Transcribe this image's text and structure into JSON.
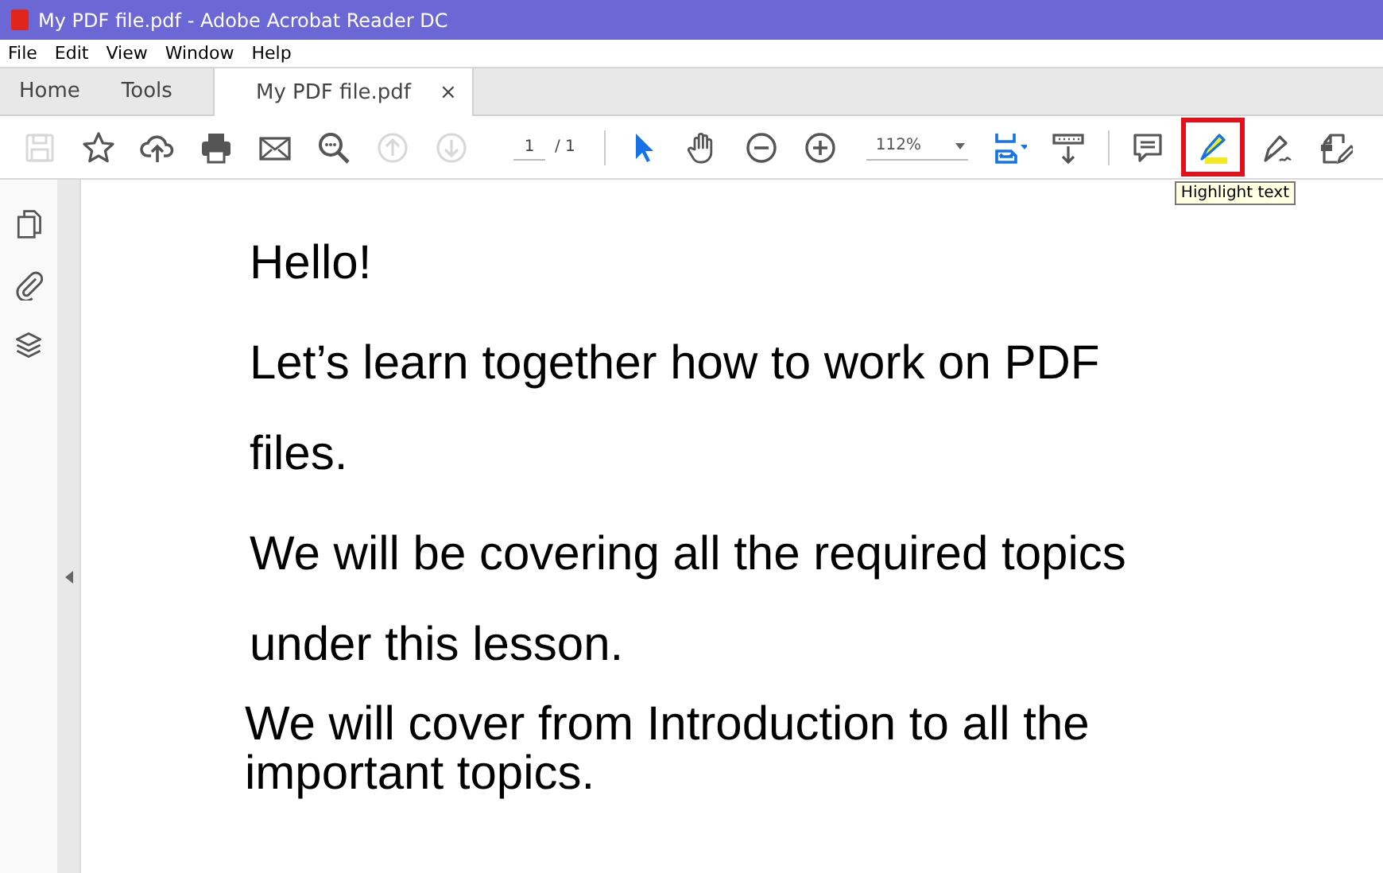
{
  "window": {
    "title": "My PDF file.pdf - Adobe Acrobat Reader DC"
  },
  "menu_bar": [
    "File",
    "Edit",
    "View",
    "Window",
    "Help"
  ],
  "tabs": [
    {
      "label": "Home",
      "selected": false
    },
    {
      "label": "Tools",
      "selected": false
    },
    {
      "label": "My PDF file.pdf",
      "selected": true,
      "close_glyph": "×"
    }
  ],
  "toolbar": [
    {
      "kind": "button",
      "disabled": true,
      "outlined": false
    },
    {
      "kind": "button",
      "disabled": false,
      "outlined": false
    },
    {
      "kind": "button",
      "disabled": false,
      "outlined": false
    },
    {
      "kind": "button",
      "disabled": false,
      "outlined": false
    },
    {
      "kind": "button",
      "disabled": false,
      "outlined": false
    },
    {
      "kind": "button",
      "disabled": false,
      "outlined": false
    },
    {
      "kind": "button",
      "disabled": true,
      "outlined": false
    },
    {
      "kind": "button",
      "disabled": true,
      "outlined": false
    },
    {
      "kind": "page",
      "value": "1",
      "total": "/ 1"
    },
    {
      "kind": "divider"
    },
    {
      "kind": "button",
      "disabled": false,
      "outlined": false
    },
    {
      "kind": "button",
      "disabled": false,
      "outlined": false
    },
    {
      "kind": "button",
      "disabled": false,
      "outlined": false
    },
    {
      "kind": "button",
      "disabled": false,
      "outlined": false
    },
    {
      "kind": "zoom",
      "value": "112%"
    },
    {
      "kind": "button",
      "disabled": false,
      "outlined": false
    },
    {
      "kind": "button",
      "disabled": false,
      "outlined": false
    },
    {
      "kind": "divider"
    },
    {
      "kind": "button",
      "disabled": false,
      "outlined": false
    },
    {
      "kind": "button",
      "disabled": false,
      "outlined": true,
      "tooltip": "Highlight text"
    },
    {
      "kind": "button",
      "disabled": false,
      "outlined": false
    },
    {
      "kind": "button",
      "disabled": false,
      "outlined": false
    }
  ],
  "document": {
    "paragraphs": [
      {
        "kind": "body",
        "text": "Hello!"
      },
      {
        "kind": "body",
        "text": "Let’s learn together how to work on PDF files."
      },
      {
        "kind": "body",
        "text": "We will be covering all the required topics under this lesson."
      },
      {
        "kind": "tight",
        "text": "We will cover from Introduction to all the important topics."
      }
    ]
  }
}
